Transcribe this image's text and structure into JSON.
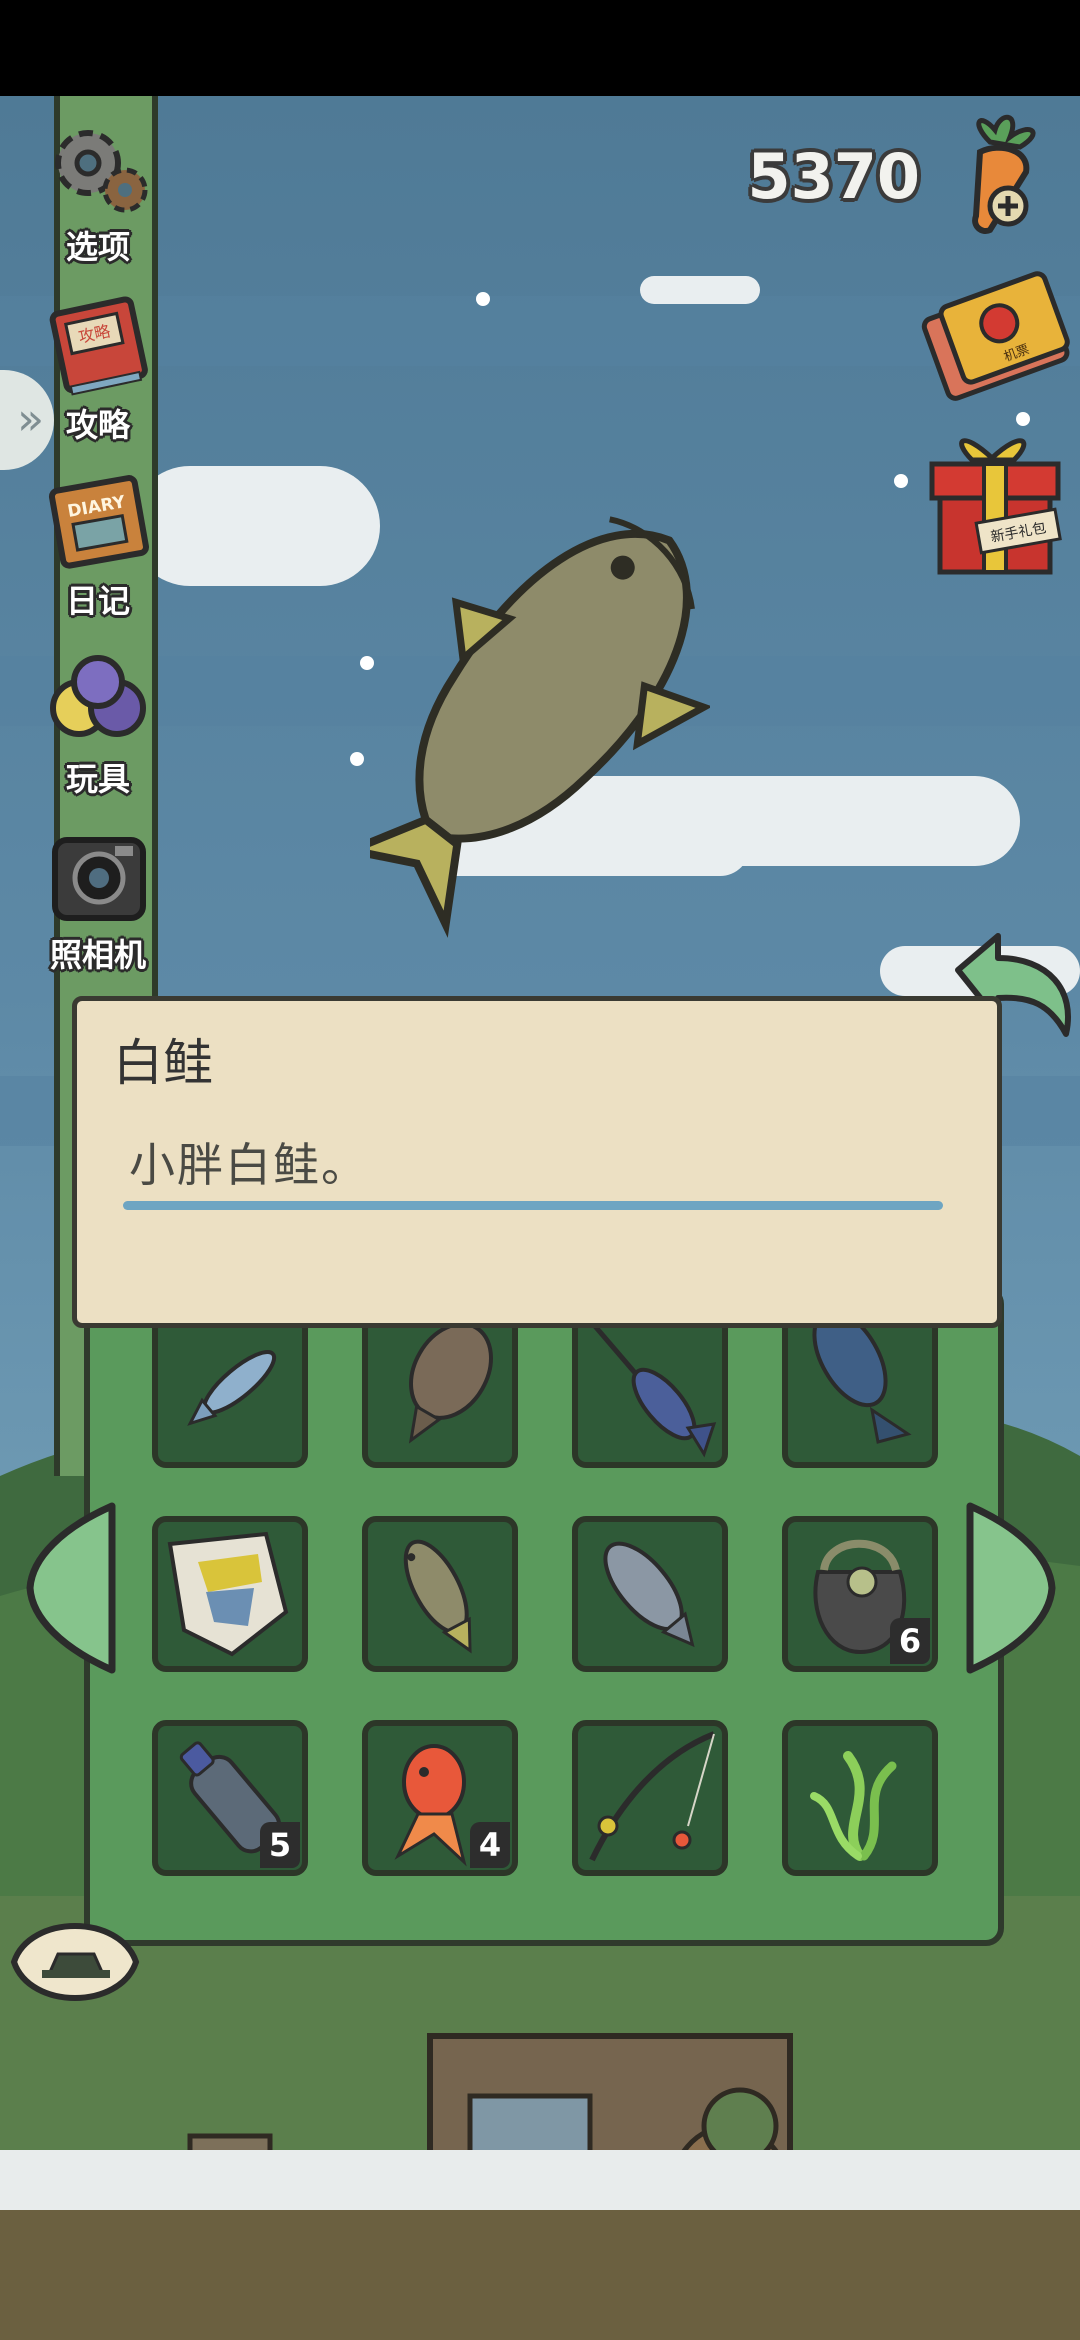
{
  "hud": {
    "coin_count": "5370",
    "gift_label": "新手礼包",
    "ticket_label": "机票"
  },
  "menu": {
    "items": [
      {
        "label": "选项",
        "icon": "gear-icon"
      },
      {
        "label": "攻略",
        "icon": "guidebook-icon"
      },
      {
        "label": "日记",
        "icon": "diary-icon"
      },
      {
        "label": "玩具",
        "icon": "toys-icon"
      },
      {
        "label": "照相机",
        "icon": "camera-icon"
      }
    ],
    "diary_cover_text": "DIARY",
    "guide_cover_text": "攻略"
  },
  "dialog": {
    "title": "白鲑",
    "description": "小胖白鲑。"
  },
  "inventory": {
    "rows": [
      [
        {
          "item": "sardine",
          "icon": "sardine-icon"
        },
        {
          "item": "flounder",
          "icon": "flounder-icon"
        },
        {
          "item": "swordfish",
          "icon": "swordfish-icon"
        },
        {
          "item": "tuna",
          "icon": "tuna-icon"
        }
      ],
      [
        {
          "item": "triggerfish",
          "icon": "triggerfish-icon"
        },
        {
          "item": "whitefish",
          "icon": "whitefish-icon"
        },
        {
          "item": "salmon",
          "icon": "salmon-icon"
        },
        {
          "item": "junk-bag",
          "icon": "junk-bag-icon",
          "qty": "6"
        }
      ],
      [
        {
          "item": "plastic-bottle",
          "icon": "plastic-bottle-icon",
          "qty": "5"
        },
        {
          "item": "goldfish",
          "icon": "goldfish-icon",
          "qty": "4"
        },
        {
          "item": "fishing-rod",
          "icon": "fishing-rod-icon"
        },
        {
          "item": "seaweed",
          "icon": "seaweed-icon"
        }
      ]
    ]
  },
  "colors": {
    "sky": "#5d89a6",
    "panel_green": "#5a9a5c",
    "slot_dark": "#2f5a38",
    "dialog_bg": "#ece0c3",
    "accent_line": "#6ea5c2",
    "menu_pole": "#6c9b63"
  }
}
